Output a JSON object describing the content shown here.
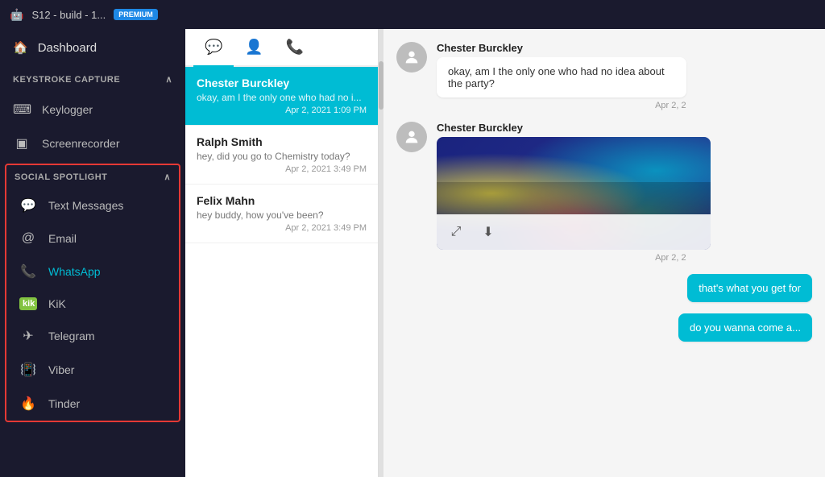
{
  "topBar": {
    "deviceName": "S12 - build - 1...",
    "badgeLabel": "PREMIUM"
  },
  "sidebar": {
    "dashboard": {
      "label": "Dashboard"
    },
    "keystroke": {
      "header": "KEYSTROKE CAPTURE",
      "items": [
        {
          "id": "keylogger",
          "label": "Keylogger",
          "icon": "⌨"
        },
        {
          "id": "screenrecorder",
          "label": "Screenrecorder",
          "icon": "⬛"
        }
      ]
    },
    "social": {
      "header": "SOCIAL SPOTLIGHT",
      "items": [
        {
          "id": "text-messages",
          "label": "Text Messages",
          "icon": "💬"
        },
        {
          "id": "email",
          "label": "Email",
          "icon": "@"
        },
        {
          "id": "whatsapp",
          "label": "WhatsApp",
          "icon": "📞",
          "active": true
        },
        {
          "id": "kik",
          "label": "KiK",
          "icon": "kik"
        },
        {
          "id": "telegram",
          "label": "Telegram",
          "icon": "✈"
        },
        {
          "id": "viber",
          "label": "Viber",
          "icon": "📳"
        },
        {
          "id": "tinder",
          "label": "Tinder",
          "icon": "🔥"
        }
      ]
    }
  },
  "tabs": [
    {
      "id": "chat",
      "icon": "💬",
      "active": true
    },
    {
      "id": "contacts",
      "icon": "👤",
      "active": false
    },
    {
      "id": "calls",
      "icon": "📞",
      "active": false
    }
  ],
  "conversations": [
    {
      "id": "chester",
      "name": "Chester Burckley",
      "preview": "okay, am I the only one who had no i...",
      "time": "Apr 2, 2021 1:09 PM",
      "selected": true
    },
    {
      "id": "ralph",
      "name": "Ralph Smith",
      "preview": "hey, did you go to Chemistry today?",
      "time": "Apr 2, 2021 3:49 PM",
      "selected": false
    },
    {
      "id": "felix",
      "name": "Felix Mahn",
      "preview": "hey buddy, how you've been?",
      "time": "Apr 2, 2021 3:49 PM",
      "selected": false
    }
  ],
  "chat": {
    "messages": [
      {
        "id": "msg1",
        "sender": "Chester Burckley",
        "text": "okay, am I the only one who had no idea about the party?",
        "time": "Apr 2, 2",
        "type": "text",
        "outgoing": false
      },
      {
        "id": "msg2",
        "sender": "Chester Burckley",
        "text": "",
        "time": "Apr 2, 2",
        "type": "image",
        "outgoing": false
      },
      {
        "id": "msg3",
        "sender": "",
        "text": "that's what you get for",
        "time": "",
        "type": "text",
        "outgoing": true
      },
      {
        "id": "msg4",
        "sender": "",
        "text": "do you wanna come a...",
        "time": "",
        "type": "text",
        "outgoing": true
      }
    ]
  }
}
